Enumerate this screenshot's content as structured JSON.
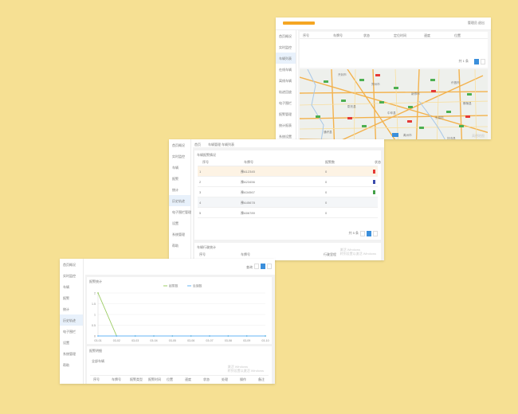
{
  "screen1": {
    "brand_color": "#f5a623",
    "user_label": "管理员 退出",
    "sidebar": [
      "首页概况",
      "实时监控",
      "车辆列表",
      "在线车辆",
      "离线车辆",
      "轨迹回放",
      "电子围栏",
      "报警管理",
      "统计报表",
      "系统设置"
    ],
    "table_headers": [
      "序号",
      "车牌号",
      "状态",
      "定位时间",
      "速度",
      "位置"
    ],
    "pager_label": "共 1 条",
    "map_labels": [
      "开封市",
      "郑州市",
      "新郑市",
      "许昌市",
      "尉氏县",
      "中牟县",
      "长葛市",
      "鄢陵县",
      "通许县",
      "禹州市",
      "扶沟县"
    ],
    "map_watermark": "高德地图"
  },
  "screen2": {
    "breadcrumb": [
      "首页",
      "车辆管理",
      "车辆列表"
    ],
    "sidebar": [
      "首页概况",
      "实时监控",
      "车辆",
      "报警",
      "统计",
      "历史轨迹",
      "电子围栏管理",
      "设置",
      "系统管理",
      "帮助"
    ],
    "active_index": 5,
    "panel1_title": "车辆报警情况",
    "col_headers": [
      "序号",
      "车牌号",
      "报警数",
      "状态"
    ],
    "rows": [
      {
        "no": "1",
        "plate": "豫A12345",
        "count": "0",
        "flag": "#e53935"
      },
      {
        "no": "2",
        "plate": "豫A23456",
        "count": "0",
        "flag": "#3949ab"
      },
      {
        "no": "3",
        "plate": "豫A34567",
        "count": "0",
        "flag": "#43a047"
      },
      {
        "no": "4",
        "plate": "豫A45678",
        "count": "0",
        "flag": ""
      },
      {
        "no": "5",
        "plate": "豫A56789",
        "count": "0",
        "flag": ""
      }
    ],
    "pager_label": "共 5 条",
    "panel2_title": "车辆行驶统计",
    "panel2_headers": [
      "序号",
      "车牌号",
      "行驶里程"
    ],
    "watermark": "激活 Windows\n转到设置以激活 Windows"
  },
  "screen3": {
    "sidebar": [
      "首页概况",
      "实时监控",
      "车辆",
      "报警",
      "统计",
      "历史轨迹",
      "电子围栏",
      "设置",
      "系统管理",
      "帮助"
    ],
    "active_index": 5,
    "search_label": "查询",
    "chart_title": "报警统计",
    "legend": [
      "报警数",
      "处理数"
    ],
    "chart_colors": [
      "#9ccc65",
      "#64b5f6"
    ],
    "table_title": "报警明细",
    "table_filter": "全部车辆",
    "table_headers": [
      "序号",
      "车牌号",
      "报警类型",
      "报警时间",
      "位置",
      "速度",
      "状态",
      "处理",
      "操作",
      "备注"
    ],
    "watermark": "激活 Windows\n转到设置以激活 Windows"
  },
  "chart_data": {
    "type": "line",
    "title": "",
    "x": [
      "03-01",
      "03-02",
      "03-03",
      "03-04",
      "03-05",
      "03-06",
      "03-07",
      "03-08",
      "03-09",
      "03-10"
    ],
    "series": [
      {
        "name": "报警数",
        "values": [
          2,
          0,
          0,
          0,
          0,
          0,
          0,
          0,
          0,
          0
        ]
      },
      {
        "name": "处理数",
        "values": [
          0,
          0,
          0,
          0,
          0,
          0,
          0,
          0,
          0,
          0
        ]
      }
    ],
    "ylim": [
      0,
      2
    ],
    "grid": true,
    "legend_position": "top-center"
  }
}
